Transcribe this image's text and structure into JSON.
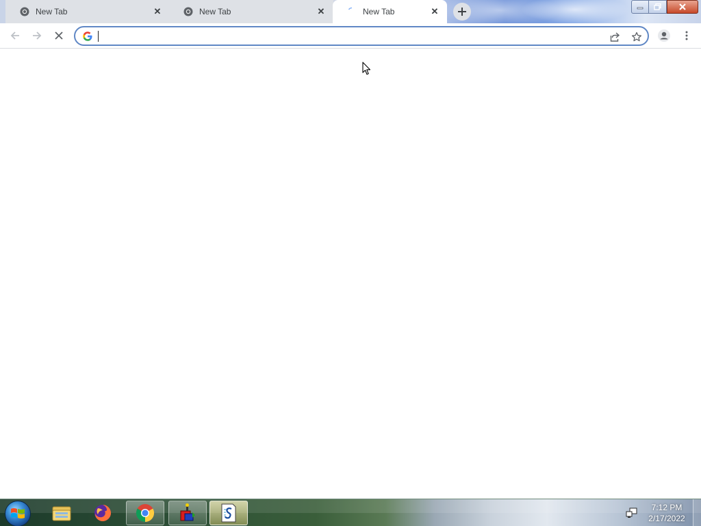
{
  "tabs": [
    {
      "title": "New Tab",
      "icon": "chrome-favicon-icon",
      "active": false
    },
    {
      "title": "New Tab",
      "icon": "chrome-favicon-icon",
      "active": false
    },
    {
      "title": "New Tab",
      "icon": "loading-spinner-icon",
      "active": true
    }
  ],
  "toolbar": {
    "back_icon": "back-arrow-icon",
    "forward_icon": "forward-arrow-icon",
    "stop_icon": "stop-loading-icon",
    "omnibox_value": "",
    "omnibox_icon": "google-g-icon",
    "share_icon": "share-icon",
    "bookmark_icon": "star-icon",
    "profile_icon": "profile-avatar-icon",
    "menu_icon": "kebab-menu-icon"
  },
  "window_controls": [
    "minimize-icon",
    "restore-icon",
    "close-icon"
  ],
  "taskbar": {
    "pinned": [
      "start-button",
      "file-explorer-icon",
      "firefox-icon",
      "chrome-icon",
      "app-installer-icon",
      "script-editor-icon"
    ],
    "clock_time": "7:12 PM",
    "clock_date": "2/17/2022"
  },
  "colors": {
    "tab_inactive": "#dee1e6",
    "tab_active": "#ffffff",
    "omnibox_focus_border": "#5f87c5",
    "close_button": "#c74a2b"
  }
}
